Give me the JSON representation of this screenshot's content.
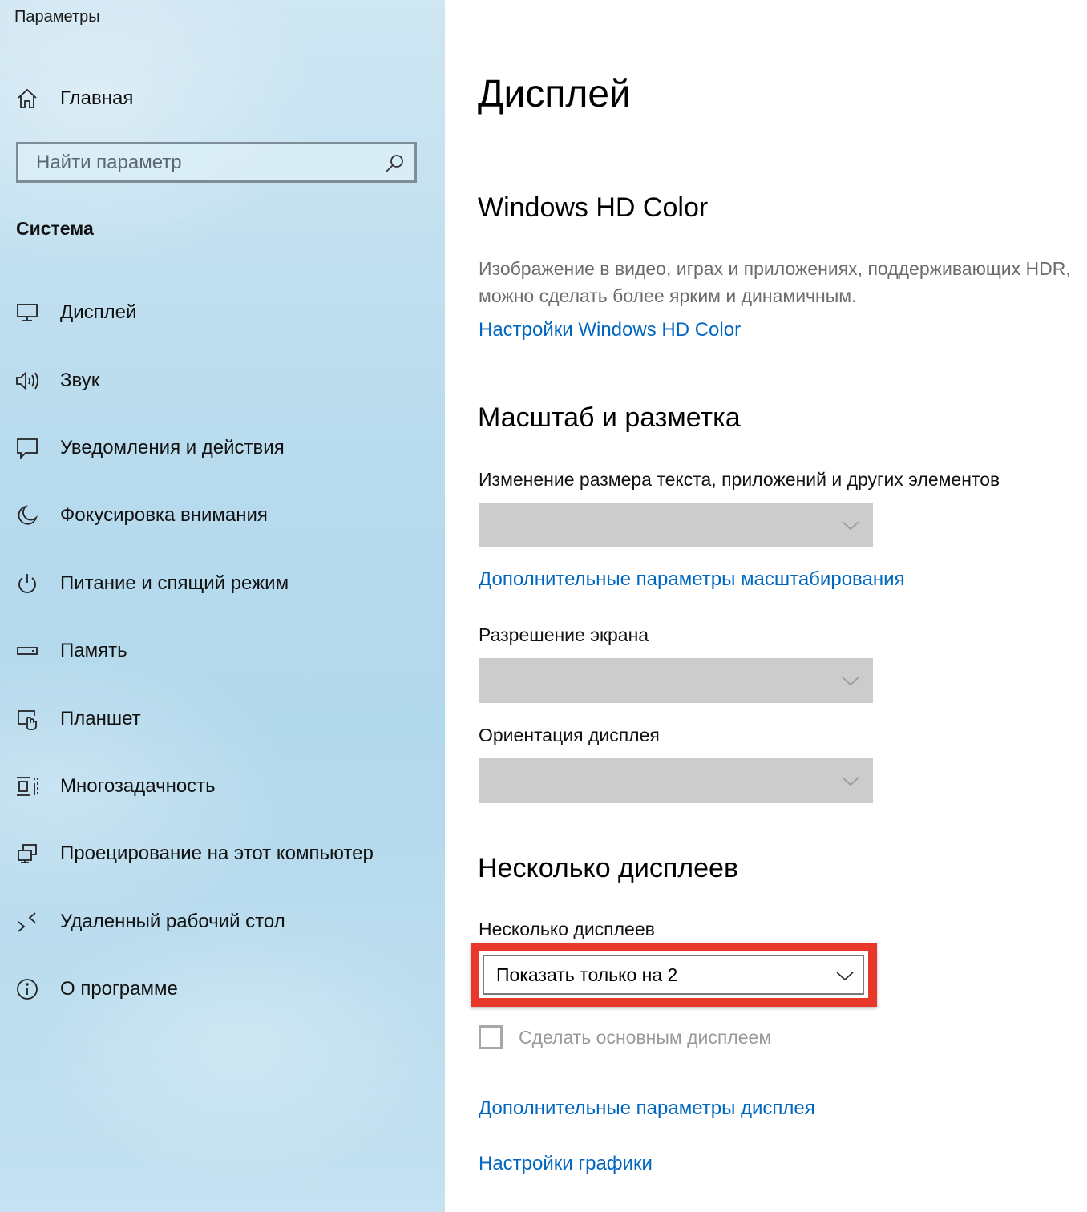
{
  "window": {
    "title": "Параметры"
  },
  "sidebar": {
    "home_label": "Главная",
    "search_placeholder": "Найти параметр",
    "section": "Система",
    "items": [
      {
        "label": "Дисплей",
        "icon": "monitor-icon"
      },
      {
        "label": "Звук",
        "icon": "speaker-icon"
      },
      {
        "label": "Уведомления и действия",
        "icon": "notification-icon"
      },
      {
        "label": "Фокусировка внимания",
        "icon": "moon-icon"
      },
      {
        "label": "Питание и спящий режим",
        "icon": "power-icon"
      },
      {
        "label": "Память",
        "icon": "storage-icon"
      },
      {
        "label": "Планшет",
        "icon": "tablet-icon"
      },
      {
        "label": "Многозадачность",
        "icon": "multitasking-icon"
      },
      {
        "label": "Проецирование на этот компьютер",
        "icon": "projecting-icon"
      },
      {
        "label": "Удаленный рабочий стол",
        "icon": "remote-desktop-icon"
      },
      {
        "label": "О программе",
        "icon": "info-icon"
      }
    ]
  },
  "main": {
    "title": "Дисплей",
    "hdr": {
      "heading": "Windows HD Color",
      "description": "Изображение в видео, играх и приложениях, поддерживающих HDR, можно сделать более ярким и динамичным.",
      "link": "Настройки Windows HD Color"
    },
    "scale": {
      "heading": "Масштаб и разметка",
      "size_label": "Изменение размера текста, приложений и других элементов",
      "advanced_link": "Дополнительные параметры масштабирования",
      "resolution_label": "Разрешение экрана",
      "orientation_label": "Ориентация дисплея"
    },
    "multi": {
      "heading": "Несколько дисплеев",
      "label": "Несколько дисплеев",
      "value": "Показать только на 2",
      "checkbox_label": "Сделать основным дисплеем",
      "checkbox_checked": false,
      "advanced_link": "Дополнительные параметры дисплея",
      "graphics_link": "Настройки графики"
    }
  },
  "colors": {
    "link": "#0067c0",
    "highlight": "#e8382a",
    "disabled_combo": "#cccccc",
    "sidebar_bg": "#b9dcee"
  }
}
